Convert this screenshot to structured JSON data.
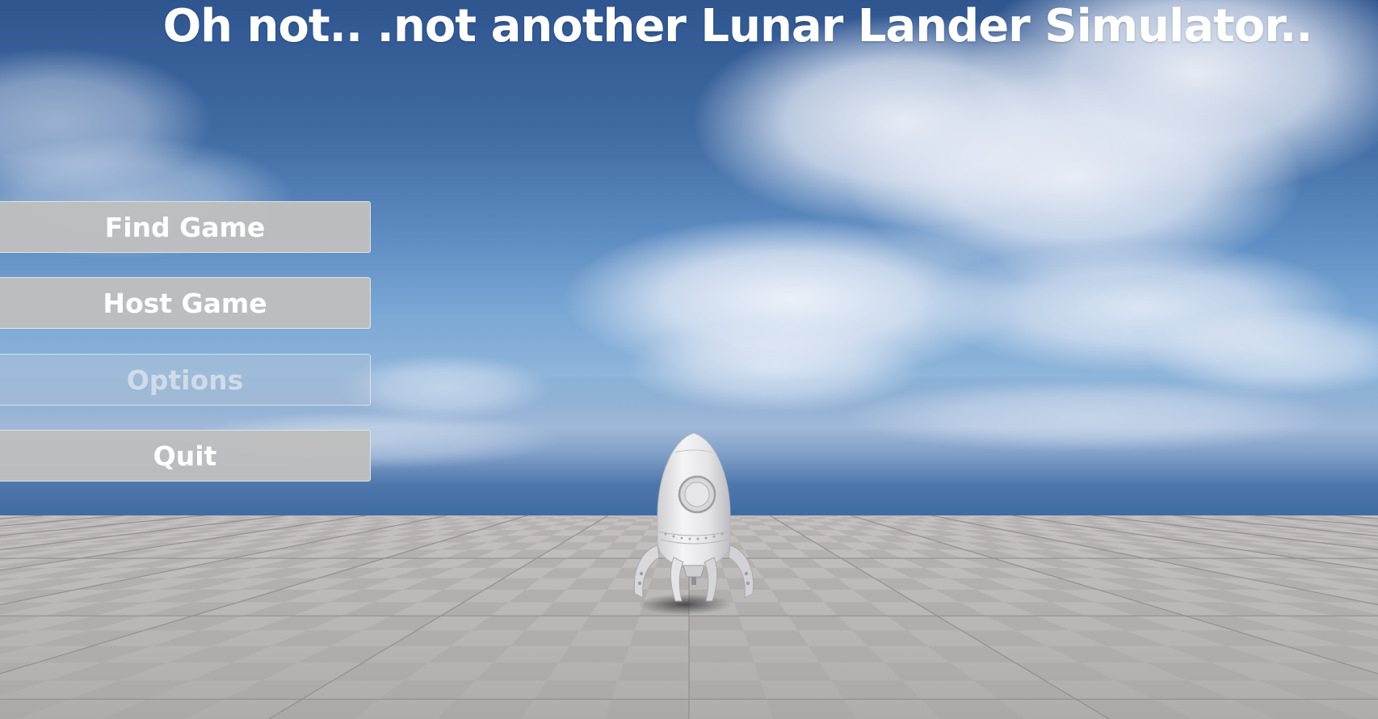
{
  "game": {
    "title": "Oh not.. .not another Lunar Lander Simulator.."
  },
  "menu": {
    "buttons": [
      {
        "label": "Find Game",
        "enabled": true
      },
      {
        "label": "Host Game",
        "enabled": true
      },
      {
        "label": "Options",
        "enabled": false
      },
      {
        "label": "Quit",
        "enabled": true
      }
    ]
  },
  "scene": {
    "sky_color": "#4a78ad",
    "ground_color": "#bab7b7",
    "button_color": "#bebebe",
    "text_color": "#ffffff"
  }
}
